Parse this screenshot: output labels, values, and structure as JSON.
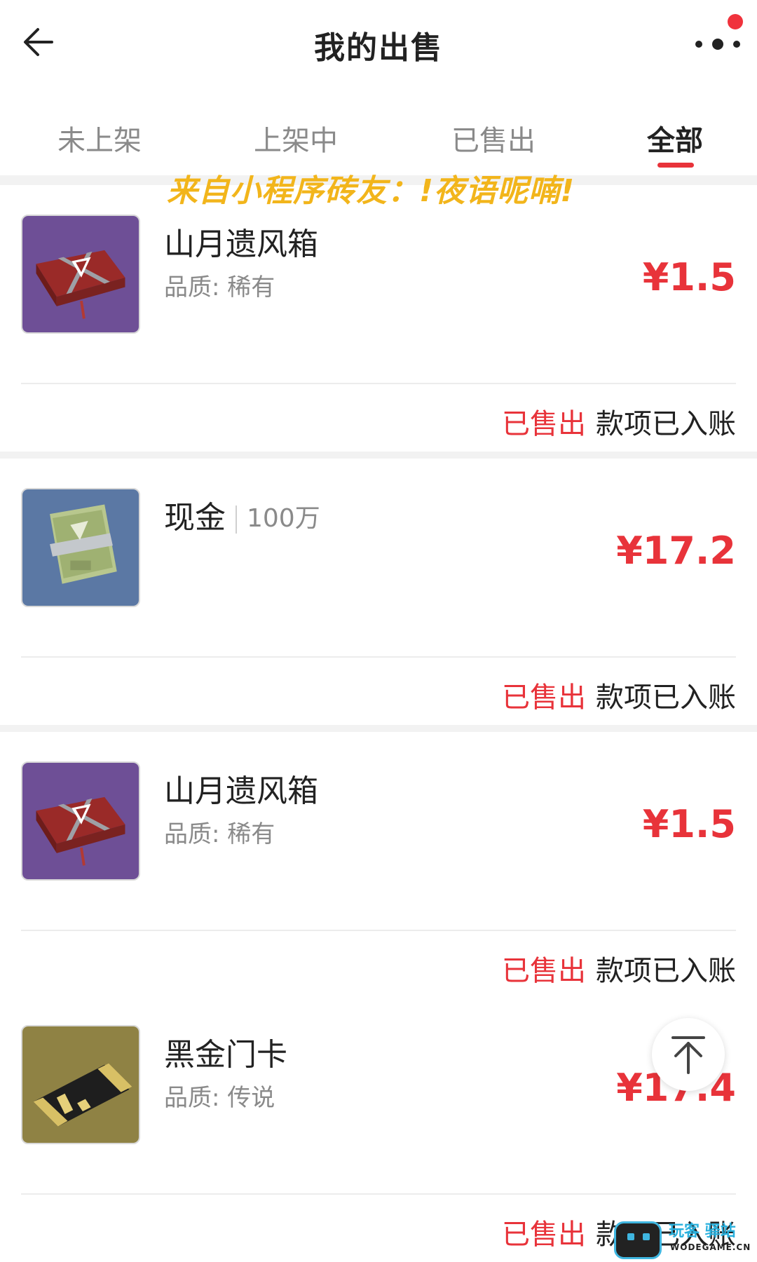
{
  "header": {
    "title": "我的出售"
  },
  "tabs": [
    {
      "label": "未上架",
      "active": false
    },
    {
      "label": "上架中",
      "active": false
    },
    {
      "label": "已售出",
      "active": false
    },
    {
      "label": "全部",
      "active": true
    }
  ],
  "watermark": "来自小程序砖友：!夜语呢喃!",
  "orders": [
    {
      "name": "山月遗风箱",
      "quality": "品质: 稀有",
      "price": "¥1.5",
      "status": "已售出",
      "status_note": "款项已入账",
      "icon": "red-supply-crate-icon"
    },
    {
      "name": "现金",
      "amount": "100万",
      "price": "¥17.2",
      "status": "已售出",
      "status_note": "款项已入账",
      "icon": "cash-stack-icon"
    },
    {
      "name": "山月遗风箱",
      "quality": "品质: 稀有",
      "price": "¥1.5",
      "status": "已售出",
      "status_note": "款项已入账",
      "icon": "red-supply-crate-icon"
    },
    {
      "name": "黑金门卡",
      "quality": "品质: 传说",
      "price": "¥17.4",
      "status": "已售出",
      "status_note": "款项已入账",
      "icon": "black-gold-pass-card-icon"
    }
  ],
  "brand": {
    "title": "玩客 驿站",
    "subtitle": "WODEGAME.CN"
  },
  "colors": {
    "accent_red": "#e8333a",
    "watermark_yellow": "#f2b51b",
    "muted_text": "#8a8a8a"
  }
}
